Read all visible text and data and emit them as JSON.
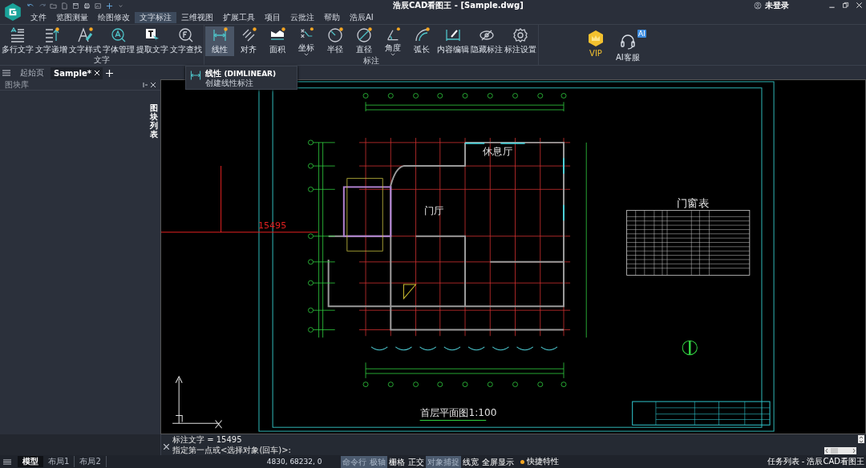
{
  "window": {
    "title": "浩辰CAD看图王 - [Sample.dwg]",
    "user": "未登录"
  },
  "menu": [
    {
      "label": "文件",
      "selected": false
    },
    {
      "label": "览图测量",
      "selected": false
    },
    {
      "label": "绘图修改",
      "selected": false
    },
    {
      "label": "文字标注",
      "selected": true
    },
    {
      "label": "三维视图",
      "selected": false
    },
    {
      "label": "扩展工具",
      "selected": false
    },
    {
      "label": "项目",
      "selected": false
    },
    {
      "label": "云批注",
      "selected": false
    },
    {
      "label": "帮助",
      "selected": false
    },
    {
      "label": "浩辰AI",
      "selected": false
    }
  ],
  "ribbon": {
    "groups": [
      {
        "label": "文字",
        "buttons": [
          {
            "label": "多行文字",
            "dot": false,
            "selected": false,
            "dropdown": false
          },
          {
            "label": "文字递增",
            "dot": true,
            "selected": false,
            "dropdown": false
          },
          {
            "label": "文字样式",
            "dot": true,
            "selected": false,
            "dropdown": false
          },
          {
            "label": "字体管理",
            "dot": false,
            "selected": false,
            "dropdown": false
          },
          {
            "label": "提取文字",
            "dot": false,
            "selected": false,
            "dropdown": false
          },
          {
            "label": "文字查找",
            "dot": false,
            "selected": false,
            "dropdown": false
          }
        ]
      },
      {
        "label": "标注",
        "buttons": [
          {
            "label": "线性",
            "dot": true,
            "selected": true,
            "dropdown": false
          },
          {
            "label": "对齐",
            "dot": true,
            "selected": false,
            "dropdown": false
          },
          {
            "label": "面积",
            "dot": true,
            "selected": false,
            "dropdown": false
          },
          {
            "label": "坐标",
            "dot": true,
            "selected": false,
            "dropdown": true
          },
          {
            "label": "半径",
            "dot": true,
            "selected": false,
            "dropdown": false
          },
          {
            "label": "直径",
            "dot": true,
            "selected": false,
            "dropdown": false
          },
          {
            "label": "角度",
            "dot": true,
            "selected": false,
            "dropdown": true
          },
          {
            "label": "弧长",
            "dot": true,
            "selected": false,
            "dropdown": false
          },
          {
            "label": "内容编辑",
            "dot": false,
            "selected": false,
            "dropdown": false
          },
          {
            "label": "隐藏标注",
            "dot": false,
            "selected": false,
            "dropdown": false
          },
          {
            "label": "标注设置",
            "dot": false,
            "selected": false,
            "dropdown": false
          }
        ]
      }
    ],
    "extras": [
      {
        "label": "VIP",
        "kind": "vip"
      },
      {
        "label": "AI客服",
        "kind": "support",
        "badge": "AI"
      }
    ]
  },
  "doc_tabs": [
    {
      "label": "起始页",
      "selected": false,
      "closable": false
    },
    {
      "label": "Sample*",
      "selected": true,
      "closable": true
    }
  ],
  "tooltip": {
    "title": "线性",
    "command": "(DIMLINEAR)",
    "description": "创建线性标注"
  },
  "block_panel": {
    "title": "图块库",
    "side_tab": "图块列表"
  },
  "drawing": {
    "dimension": "15495",
    "rooms": [
      "休息厅",
      "门厅"
    ],
    "title": "首层平面图1:100",
    "table_title": "门窗表"
  },
  "command_line": {
    "history": "标注文字 = 15495",
    "prompt": "指定第一点或<选择对象(回车)>:"
  },
  "status_bar": {
    "layouts": [
      {
        "label": "模型",
        "selected": true
      },
      {
        "label": "布局1",
        "selected": false
      },
      {
        "label": "布局2",
        "selected": false
      }
    ],
    "coordinates": "4830, 68232, 0",
    "toggles": [
      {
        "label": "命令行",
        "on": true
      },
      {
        "label": "极轴",
        "on": true
      },
      {
        "label": "栅格",
        "on": false
      },
      {
        "label": "正交",
        "on": false
      },
      {
        "label": "对象捕捉",
        "on": true
      },
      {
        "label": "线宽",
        "on": false
      },
      {
        "label": "全屏显示",
        "on": false
      }
    ],
    "quick_props": {
      "label": "快捷特性",
      "on": true
    },
    "task": "任务列表 - 浩辰CAD看图王"
  }
}
